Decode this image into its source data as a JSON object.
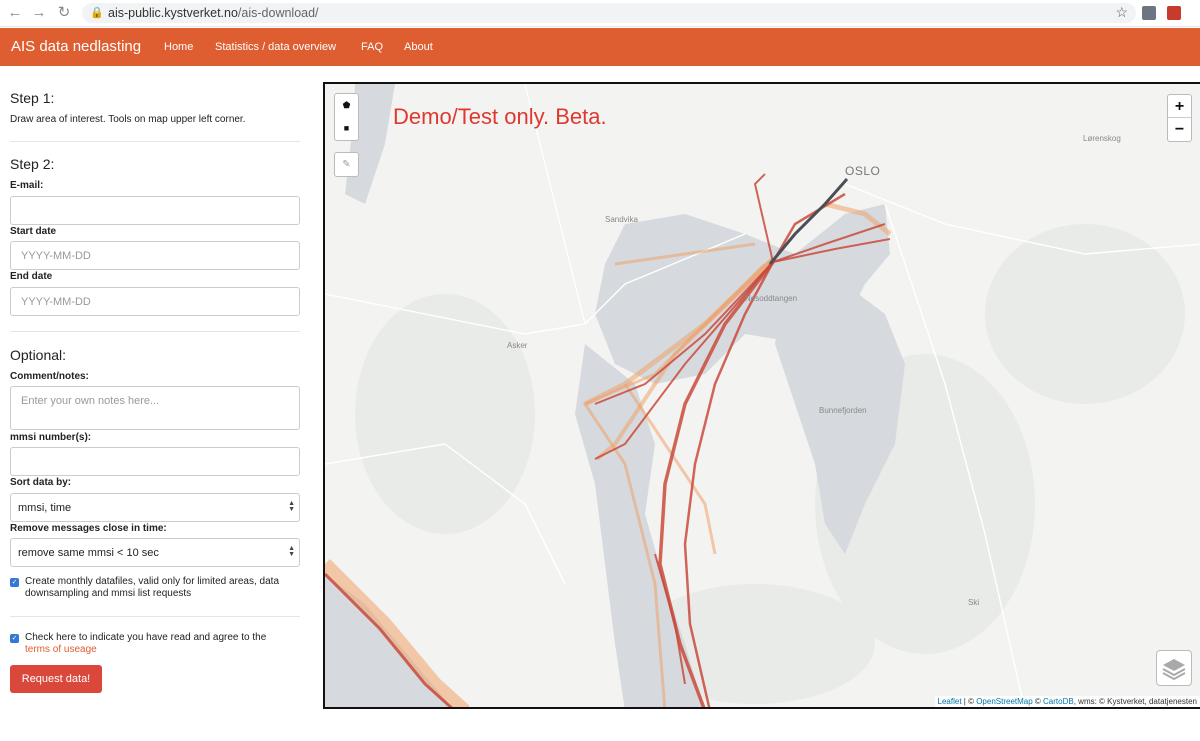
{
  "browser": {
    "url_host": "ais-public.kystverket.no",
    "url_path": "/ais-download/"
  },
  "navbar": {
    "brand": "AIS data nedlasting",
    "links": [
      "Home",
      "Statistics / data overview",
      "FAQ",
      "About"
    ]
  },
  "form": {
    "step1_title": "Step 1:",
    "step1_help": "Draw area of interest. Tools on map upper left corner.",
    "step2_title": "Step 2:",
    "email_label": "E-mail:",
    "email_value": "",
    "start_label": "Start date",
    "start_placeholder": "YYYY-MM-DD",
    "end_label": "End date",
    "end_placeholder": "YYYY-MM-DD",
    "optional_title": "Optional:",
    "comment_label": "Comment/notes:",
    "comment_placeholder": "Enter your own notes here...",
    "mmsi_label": "mmsi number(s):",
    "sort_label": "Sort data by:",
    "sort_value": "mmsi, time",
    "remove_label": "Remove messages close in time:",
    "remove_value": "remove same mmsi < 10 sec",
    "monthly_checked": true,
    "monthly_text": "Create monthly datafiles, valid only for limited areas, data downsampling and mmsi list requests",
    "agree_checked": true,
    "agree_text": "Check here to indicate you have read and agree to the",
    "terms_link": "terms of useage",
    "submit_label": "Request data!"
  },
  "map": {
    "demo_text": "Demo/Test only. Beta.",
    "places": {
      "oslo": "OSLO",
      "sandvika": "Sandvika",
      "asker": "Asker",
      "nesoddtangen": "Nesoddtangen",
      "bunnefjorden": "Bunnefjorden",
      "lorenskog": "Lørenskog",
      "ski": "Ski"
    },
    "zoom_in": "+",
    "zoom_out": "−",
    "attribution": {
      "leaflet": "Leaflet",
      "sep1": " | © ",
      "osm": "OpenStreetMap",
      "sep2": " © ",
      "carto": "CartoDB",
      "rest": ", wms: © Kystverket, datatjenesten"
    },
    "colors": {
      "track_dark": "#4a4f57",
      "track_red": "#c94a3c",
      "track_orange": "#ee9a5f",
      "water": "#d6dade"
    }
  }
}
